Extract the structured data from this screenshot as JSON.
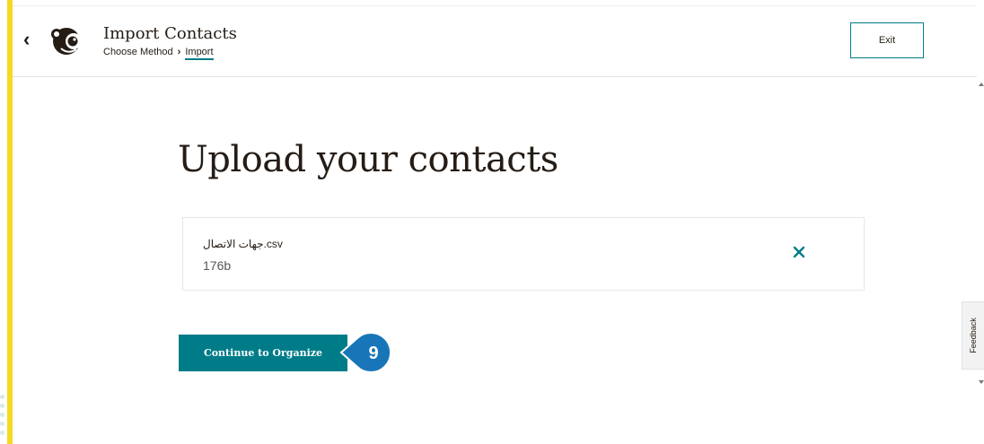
{
  "header": {
    "back_icon": "chevron-left-icon",
    "logo_icon": "mailchimp-logo-icon",
    "title": "Import Contacts",
    "breadcrumb": {
      "step1": "Choose Method",
      "separator": "›",
      "step2": "Import"
    },
    "exit_label": "Exit"
  },
  "main": {
    "heading": "Upload your contacts",
    "file": {
      "name": "جهات الاتصال.csv",
      "size": "176b",
      "remove_icon": "close-icon"
    },
    "continue_label": "Continue to Organize",
    "step_badge": "9"
  },
  "sidebar": {
    "feedback_label": "Feedback"
  },
  "colors": {
    "teal": "#007c89",
    "accent_yellow": "#f5da23",
    "callout_blue": "#1876b8"
  }
}
